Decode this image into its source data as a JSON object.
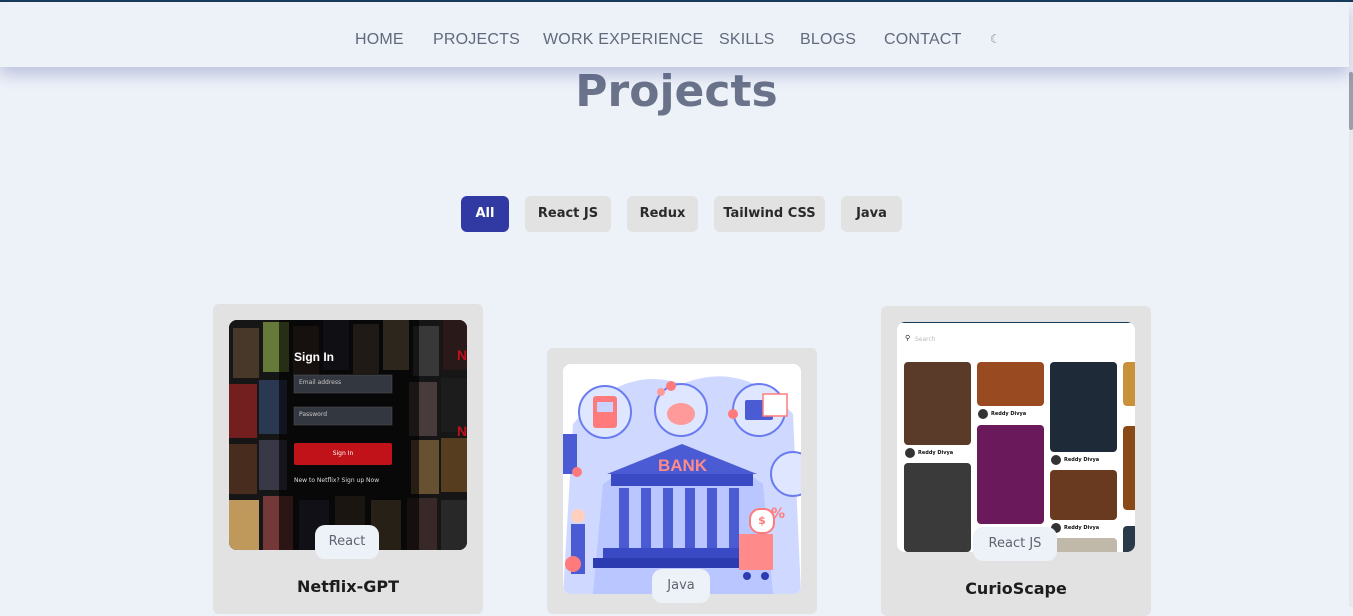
{
  "nav": {
    "items": [
      "HOME",
      "PROJECTS",
      "WORK EXPERIENCE",
      "SKILLS",
      "BLOGS",
      "CONTACT"
    ],
    "theme_icon": "moon-icon"
  },
  "page": {
    "title": "Projects"
  },
  "filters": [
    "All",
    "React JS",
    "Redux",
    "Tailwind CSS",
    "Java"
  ],
  "active_filter": "All",
  "projects": [
    {
      "title": "Netflix-GPT",
      "tag": "React",
      "preview": {
        "heading": "Sign In",
        "email_placeholder": "Email address",
        "password_placeholder": "Password",
        "button": "Sign In",
        "footer": "New to Netflix? Sign up Now"
      }
    },
    {
      "title": "",
      "tag": "Java",
      "preview": {
        "sign": "BANK",
        "percent": "%",
        "coin": "$"
      }
    },
    {
      "title": "CurioScape",
      "tag": "React JS",
      "preview": {
        "search_placeholder": "Search",
        "user": "Reddy Divya"
      }
    }
  ],
  "colors": {
    "accent": "#3139a3",
    "background": "#edf1f8",
    "card": "#e2e2e2",
    "netflix_red": "#c11119"
  }
}
